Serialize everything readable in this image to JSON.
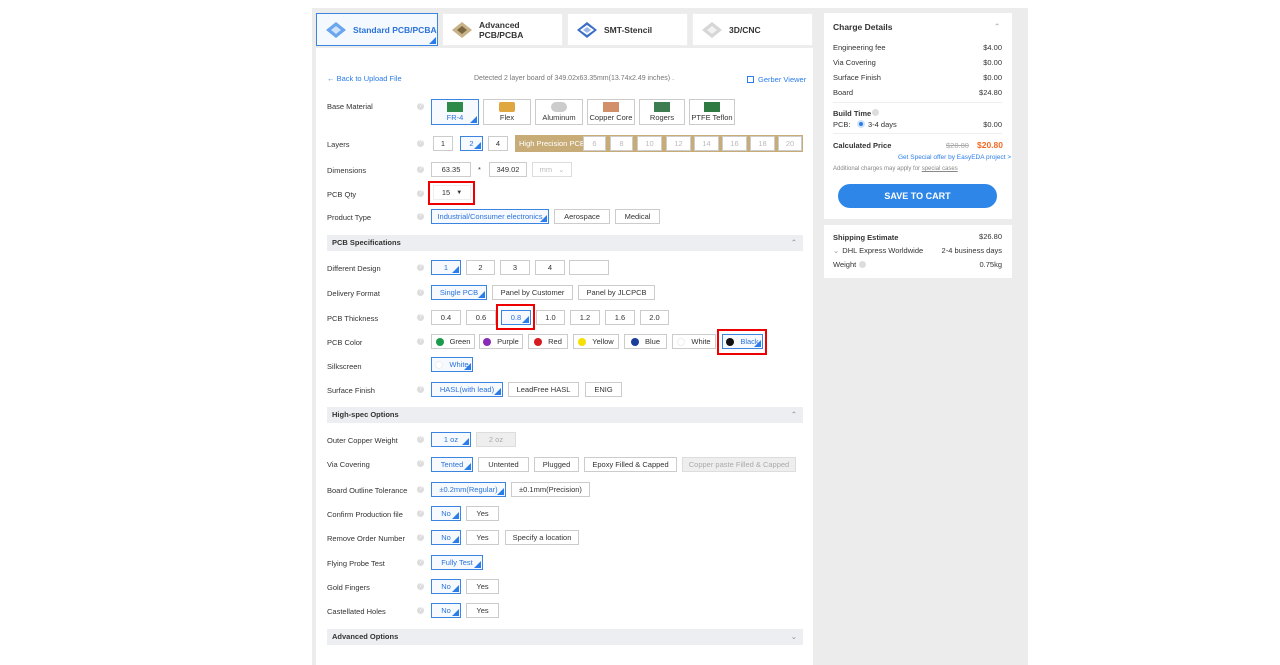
{
  "tabs": [
    "Standard PCB/PCBA",
    "Advanced PCB/PCBA",
    "SMT-Stencil",
    "3D/CNC"
  ],
  "header": {
    "back": "Back to Upload File",
    "detected": "Detected 2 layer board of 349.02x63.35mm(13.74x2.49 inches) .",
    "gerber": "Gerber Viewer"
  },
  "labels": {
    "base": "Base Material",
    "layers": "Layers",
    "dim": "Dimensions",
    "qty": "PCB Qty",
    "ptype": "Product Type",
    "spec": "PCB Specifications",
    "diff": "Different Design",
    "deliv": "Delivery Format",
    "thick": "PCB Thickness",
    "color": "PCB Color",
    "silk": "Silkscreen",
    "surf": "Surface Finish",
    "high": "High-spec Options",
    "copper": "Outer Copper Weight",
    "via": "Via Covering",
    "outline": "Board Outline Tolerance",
    "confirm": "Confirm Production file",
    "remove": "Remove Order Number",
    "probe": "Flying Probe Test",
    "gold": "Gold Fingers",
    "castel": "Castellated Holes",
    "adv": "Advanced Options"
  },
  "base": [
    "FR-4",
    "Flex",
    "Aluminum",
    "Copper Core",
    "Rogers",
    "PTFE Teflon"
  ],
  "layers": [
    "1",
    "2",
    "4"
  ],
  "hp_label": "High Precision PCB",
  "hp_layers": [
    "6",
    "8",
    "10",
    "12",
    "14",
    "16",
    "18",
    "20"
  ],
  "dims": {
    "w": "63.35",
    "x": "*",
    "h": "349.02",
    "unit": "mm"
  },
  "qty": "15",
  "ptype": [
    "Industrial/Consumer electronics",
    "Aerospace",
    "Medical"
  ],
  "diff": [
    "1",
    "2",
    "3",
    "4",
    ""
  ],
  "deliv": [
    "Single PCB",
    "Panel by Customer",
    "Panel by JLCPCB"
  ],
  "thick": [
    "0.4",
    "0.6",
    "0.8",
    "1.0",
    "1.2",
    "1.6",
    "2.0"
  ],
  "colors": [
    {
      "n": "Green",
      "c": "#1a9a4a"
    },
    {
      "n": "Purple",
      "c": "#8a2bb5"
    },
    {
      "n": "Red",
      "c": "#d71920"
    },
    {
      "n": "Yellow",
      "c": "#f5e000"
    },
    {
      "n": "Blue",
      "c": "#1a3f9a"
    },
    {
      "n": "White",
      "c": "#ffffff"
    },
    {
      "n": "Black",
      "c": "#111111"
    }
  ],
  "silk": "White",
  "surf": [
    "HASL(with lead)",
    "LeadFree HASL",
    "ENIG"
  ],
  "copper": [
    "1 oz",
    "2 oz"
  ],
  "via": [
    "Tented",
    "Untented",
    "Plugged",
    "Epoxy Filled & Capped",
    "Copper paste Filled & Capped"
  ],
  "outline": [
    "±0.2mm(Regular)",
    "±0.1mm(Precision)"
  ],
  "confirm": [
    "No",
    "Yes"
  ],
  "remove": [
    "No",
    "Yes",
    "Specify a location"
  ],
  "probe": "Fully Test",
  "gold": [
    "No",
    "Yes"
  ],
  "castel": [
    "No",
    "Yes"
  ],
  "charge": {
    "title": "Charge Details",
    "rows": [
      [
        "Engineering fee",
        "$4.00"
      ],
      [
        "Via Covering",
        "$0.00"
      ],
      [
        "Surface Finish",
        "$0.00"
      ],
      [
        "Board",
        "$24.80"
      ]
    ],
    "build": "Build Time",
    "pcb": "PCB:",
    "days": "3-4 days",
    "pcbprice": "$0.00",
    "calc": "Calculated Price",
    "old": "$28.80",
    "new": "$20.80",
    "special": "Get Special offer by EasyEDA project >",
    "note1": "Additional charges may apply for ",
    "note2": "special cases",
    "cart": "SAVE TO CART"
  },
  "ship": {
    "title": "Shipping Estimate",
    "price": "$26.80",
    "method": "DHL Express Worldwide",
    "days": "2-4 business days",
    "weight": "Weight",
    "wval": "0.75kg"
  },
  "colors_ui": {
    "accent": "#2b7de9",
    "cart": "#2e87e8",
    "price": "#f06a24",
    "red": "#e00000"
  }
}
